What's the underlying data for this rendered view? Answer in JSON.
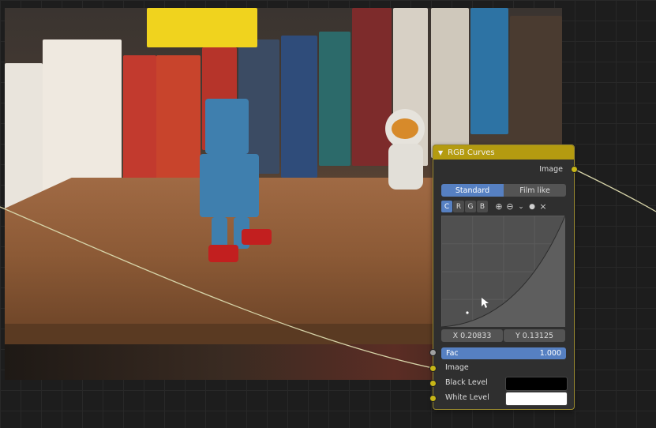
{
  "node": {
    "title": "RGB Curves",
    "output_label": "Image",
    "mode_tabs": [
      "Standard",
      "Film like"
    ],
    "active_mode": "Standard",
    "channels": [
      "C",
      "R",
      "G",
      "B"
    ],
    "active_channel": "C",
    "coords": {
      "x": "X 0.20833",
      "y": "Y 0.13125"
    },
    "fac": {
      "label": "Fac",
      "value": "1.000",
      "fill": 1.0
    },
    "inputs": {
      "image": "Image",
      "black_level": "Black Level",
      "white_level": "White Level"
    }
  },
  "colors": {
    "header": "#b49b10",
    "socket_color": "#c7b617",
    "socket_float": "#a1a1a1",
    "accent": "#5680c2",
    "black_level": "#000000",
    "white_level": "#ffffff"
  },
  "icons": [
    "collapse-triangle-icon",
    "zoom-in-icon",
    "zoom-out-icon",
    "chevron-down-icon",
    "record-dot-icon",
    "close-icon"
  ]
}
